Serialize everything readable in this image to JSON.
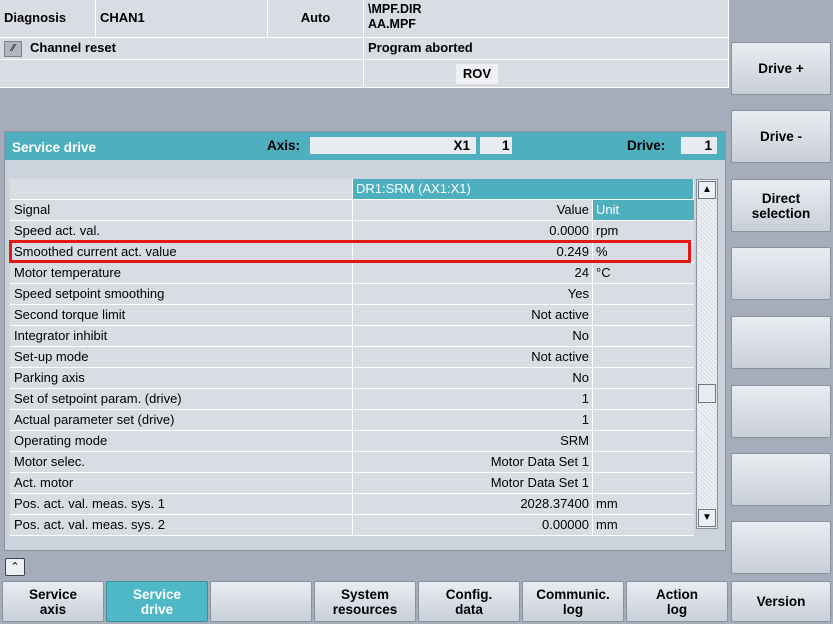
{
  "header": {
    "area": "Diagnosis",
    "channel": "CHAN1",
    "mode": "Auto",
    "program_path_line1": "\\MPF.DIR",
    "program_path_line2": "AA.MPF",
    "channel_status": "Channel reset",
    "program_status": "Program aborted",
    "rov": "ROV"
  },
  "panel": {
    "title": "Service drive",
    "axis_label": "Axis:",
    "axis_name": "X1",
    "axis_number": "1",
    "drive_label": "Drive:",
    "drive_number": "1"
  },
  "table": {
    "drive_header": "DR1:SRM (AX1:X1)",
    "columns": {
      "signal": "Signal",
      "value": "Value",
      "unit": "Unit"
    },
    "highlighted_row": "Smoothed current act. value",
    "rows": [
      {
        "signal": "Speed act. val.",
        "value": "0.0000",
        "unit": "rpm"
      },
      {
        "signal": "Smoothed current act. value",
        "value": "0.249",
        "unit": "%"
      },
      {
        "signal": "Motor temperature",
        "value": "24",
        "unit": "°C"
      },
      {
        "signal": "Speed setpoint smoothing",
        "value": "Yes",
        "unit": ""
      },
      {
        "signal": "Second torque limit",
        "value": "Not active",
        "unit": ""
      },
      {
        "signal": "Integrator inhibit",
        "value": "No",
        "unit": ""
      },
      {
        "signal": "Set-up mode",
        "value": "Not active",
        "unit": ""
      },
      {
        "signal": "Parking axis",
        "value": "No",
        "unit": ""
      },
      {
        "signal": "Set of setpoint param. (drive)",
        "value": "1",
        "unit": ""
      },
      {
        "signal": "Actual parameter set (drive)",
        "value": "1",
        "unit": ""
      },
      {
        "signal": "Operating mode",
        "value": "SRM",
        "unit": ""
      },
      {
        "signal": "Motor selec.",
        "value": "Motor Data Set 1",
        "unit": ""
      },
      {
        "signal": "Act. motor",
        "value": "Motor Data Set 1",
        "unit": ""
      },
      {
        "signal": "Pos. act. val. meas. sys. 1",
        "value": "2028.37400",
        "unit": "mm"
      },
      {
        "signal": "Pos. act. val. meas. sys. 2",
        "value": "0.00000",
        "unit": "mm"
      }
    ]
  },
  "side_softkeys": [
    "Drive +",
    "Drive -",
    "Direct\nselection",
    "",
    "",
    "",
    "",
    "",
    ""
  ],
  "bottom_softkeys": [
    {
      "label": "Service\naxis",
      "active": false
    },
    {
      "label": "Service\ndrive",
      "active": true
    },
    {
      "label": "",
      "active": false
    },
    {
      "label": "System\nresources",
      "active": false
    },
    {
      "label": "Config.\ndata",
      "active": false
    },
    {
      "label": "Communic.\nlog",
      "active": false
    },
    {
      "label": "Action\nlog",
      "active": false
    },
    {
      "label": "Version",
      "active": false
    }
  ],
  "icons": {
    "reset": "channel-reset-icon",
    "expand": "chevron-up-icon",
    "scroll_up": "scroll-up-icon",
    "scroll_down": "scroll-down-icon"
  },
  "colors": {
    "accent": "#4eafbf",
    "highlight": "#e01818",
    "background": "#a4adb9"
  }
}
